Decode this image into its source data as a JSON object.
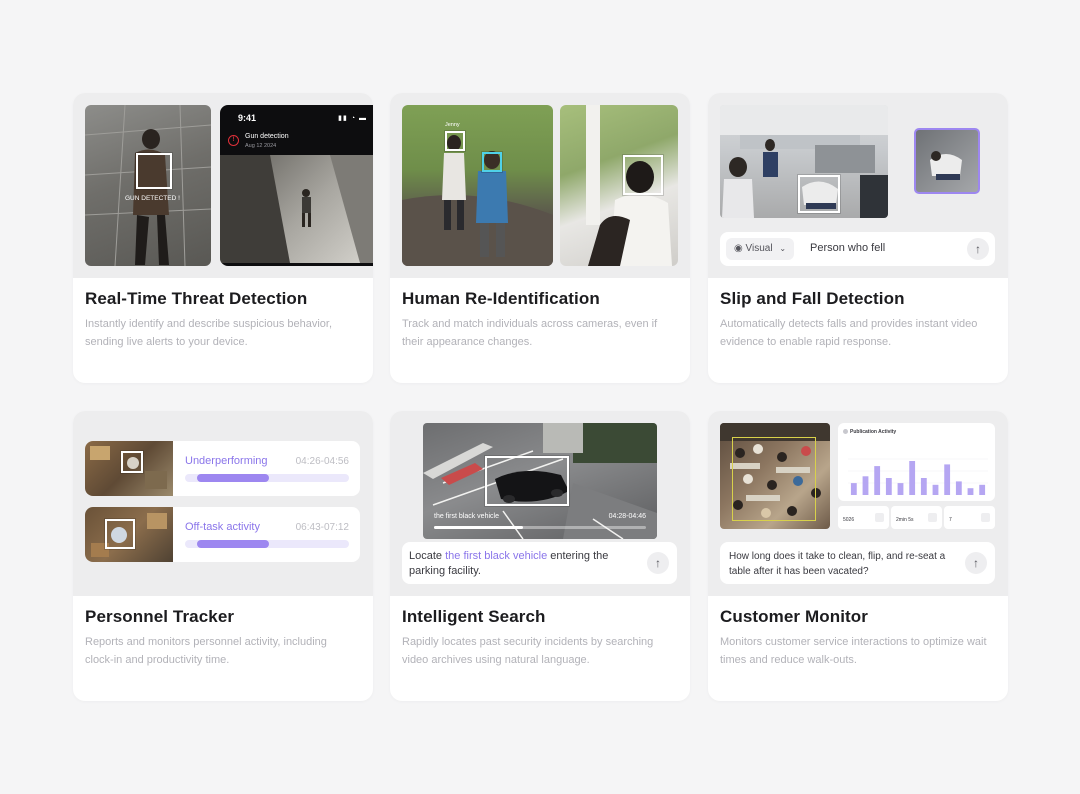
{
  "colors": {
    "background": "#f5f5f6",
    "accent": "#8a75ea",
    "accent_fill": "#9d87f0",
    "alert": "#e0303a"
  },
  "cards": [
    {
      "title": "Real-Time Threat Detection",
      "description": "Instantly identify and describe suspicious behavior, sending live alerts to your device.",
      "detection_label": "GUN DETECTED !",
      "phone": {
        "time": "9:41",
        "status_icons": "signal-wifi-battery-icon",
        "alert_title": "Gun detection",
        "alert_date": "Aug 12 2024"
      }
    },
    {
      "title": "Human Re-Identification",
      "description": "Track and match individuals across cameras, even if their appearance changes.",
      "person_tag": "Jenny"
    },
    {
      "title": "Slip and Fall Detection",
      "description": "Automatically detects falls and provides instant video evidence to enable rapid response.",
      "query": {
        "mode": "Visual",
        "text": "Person who fell",
        "mode_icon": "eye-icon",
        "send_icon": "arrow-up-icon"
      }
    },
    {
      "title": "Personnel Tracker",
      "description": "Reports and monitors personnel activity, including clock-in and productivity time.",
      "rows": [
        {
          "label": "Underperforming",
          "time": "04:26-04:56",
          "progress": 0.44
        },
        {
          "label": "Off-task activity",
          "time": "06:43-07:12",
          "progress": 0.44
        }
      ]
    },
    {
      "title": "Intelligent Search",
      "description": "Rapidly locates past security incidents by searching video archives using natural language.",
      "video_caption": "the first black vehicle",
      "video_time": "04:28-04:46",
      "video_progress": 0.42,
      "query": {
        "before": "Locate ",
        "highlight": "the first black vehicle",
        "after": " entering the parking facility.",
        "send_icon": "arrow-up-icon"
      }
    },
    {
      "title": "Customer Monitor",
      "description": "Monitors customer service interactions to optimize wait times and reduce walk-outs.",
      "panel": {
        "title": "Publication Activity",
        "bars": [
          0.35,
          0.55,
          0.85,
          0.5,
          0.35,
          1.0,
          0.5,
          0.3,
          0.9,
          0.4,
          0.2,
          0.3
        ],
        "stats": [
          {
            "label": "",
            "value": "5026"
          },
          {
            "label": "",
            "value": "2min 5s"
          },
          {
            "label": "",
            "value": "7"
          }
        ]
      },
      "query": {
        "text": "How long does it take to clean, flip, and re-seat a table after it has been vacated?",
        "send_icon": "arrow-up-icon"
      }
    }
  ]
}
